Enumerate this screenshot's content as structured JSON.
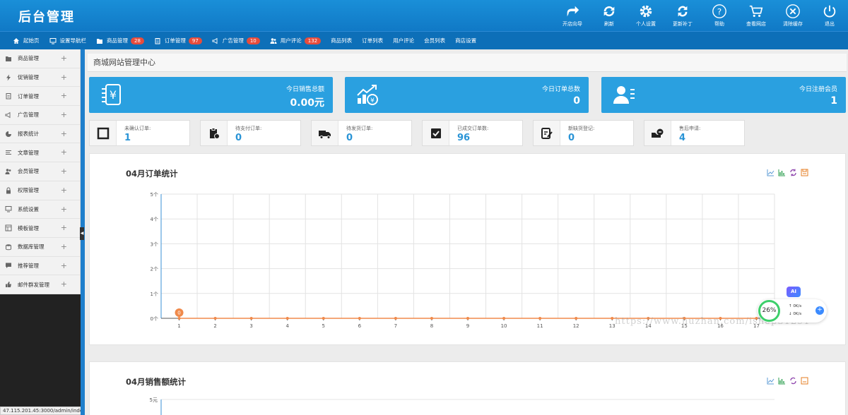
{
  "app": {
    "title": "后台管理"
  },
  "header_actions": [
    {
      "label": "开店向导",
      "icon": "share-arrow-icon"
    },
    {
      "label": "刷新",
      "icon": "refresh-icon"
    },
    {
      "label": "个人设置",
      "icon": "gear-icon"
    },
    {
      "label": "更新补丁",
      "icon": "update-icon"
    },
    {
      "label": "帮助",
      "icon": "help-icon"
    },
    {
      "label": "查看网店",
      "icon": "cart-icon"
    },
    {
      "label": "清除缓存",
      "icon": "clear-icon"
    },
    {
      "label": "退出",
      "icon": "power-icon"
    }
  ],
  "nav": [
    {
      "label": "起始页",
      "icon": "home-icon"
    },
    {
      "label": "设置导航栏",
      "icon": "monitor-icon"
    },
    {
      "label": "商品管理",
      "icon": "folder-icon",
      "badge": "28"
    },
    {
      "label": "订单管理",
      "icon": "clipboard-icon",
      "badge": "97"
    },
    {
      "label": "广告管理",
      "icon": "megaphone-icon",
      "badge": "10"
    },
    {
      "label": "用户评论",
      "icon": "users-icon",
      "badge": "132"
    },
    {
      "label": "商品列表"
    },
    {
      "label": "订单列表"
    },
    {
      "label": "用户评论"
    },
    {
      "label": "会员列表"
    },
    {
      "label": "商店设置"
    }
  ],
  "sidebar": [
    {
      "label": "商品管理",
      "icon": "folder-icon"
    },
    {
      "label": "促销管理",
      "icon": "flash-icon"
    },
    {
      "label": "订单管理",
      "icon": "clipboard-icon"
    },
    {
      "label": "广告管理",
      "icon": "megaphone-icon"
    },
    {
      "label": "报表统计",
      "icon": "pie-chart-icon"
    },
    {
      "label": "文章管理",
      "icon": "list-icon"
    },
    {
      "label": "会员管理",
      "icon": "users-icon"
    },
    {
      "label": "权限管理",
      "icon": "lock-icon"
    },
    {
      "label": "系统设置",
      "icon": "monitor-icon"
    },
    {
      "label": "模板管理",
      "icon": "template-icon"
    },
    {
      "label": "数据库管理",
      "icon": "database-icon"
    },
    {
      "label": "推荐管理",
      "icon": "comment-icon"
    },
    {
      "label": "邮件群发管理",
      "icon": "thumbs-up-icon"
    }
  ],
  "status_url": "47.115.201.45:3000/admin/index.php?act=main",
  "main": {
    "title": "商城网站管理中心",
    "stats": [
      {
        "label": "今日销售总额",
        "value": "0.00元",
        "icon": "yen-icon"
      },
      {
        "label": "今日订单总数",
        "value": "0",
        "icon": "growth-chart-icon"
      },
      {
        "label": "今日注册会员",
        "value": "1",
        "icon": "member-card-icon"
      }
    ],
    "minis": [
      {
        "label": "未确认订单:",
        "value": "1",
        "icon": "square-icon"
      },
      {
        "label": "待支付订单:",
        "value": "0",
        "icon": "pay-clipboard-icon"
      },
      {
        "label": "待发货订单:",
        "value": "0",
        "icon": "truck-icon"
      },
      {
        "label": "已成交订单数:",
        "value": "96",
        "icon": "done-order-icon"
      },
      {
        "label": "新缺货登记:",
        "value": "0",
        "icon": "register-icon"
      },
      {
        "label": "售后申请:",
        "value": "4",
        "icon": "aftersale-icon"
      }
    ],
    "order_panel_title": "04月订单统计",
    "sales_panel_title": "04月销售额统计",
    "sales_top_tick": "5元"
  },
  "chart_data": {
    "type": "line",
    "title": "04月订单统计",
    "x": [
      1,
      2,
      3,
      4,
      5,
      6,
      7,
      8,
      9,
      10,
      11,
      12,
      13,
      14,
      15,
      16,
      17
    ],
    "categories": [
      "1",
      "2",
      "3",
      "4",
      "5",
      "6",
      "7",
      "8",
      "9",
      "10",
      "11",
      "12",
      "13",
      "14",
      "15",
      "16",
      "17"
    ],
    "series": [
      {
        "values": [
          0,
          0,
          0,
          0,
          0,
          0,
          0,
          0,
          0,
          0,
          0,
          0,
          0,
          0,
          0,
          0,
          0
        ]
      }
    ],
    "data_labels": [
      "0"
    ],
    "yticks": [
      "0个",
      "1个",
      "2个",
      "3个",
      "4个",
      "5个"
    ],
    "ylim": [
      0,
      5
    ],
    "grid": true,
    "color": "#f08a4b"
  },
  "overlay": {
    "watermark": "https://www.huzhan.com/ishop31291",
    "ai_label": "AI",
    "speed_percent": "26%",
    "up_speed": "0K/s",
    "down_speed": "0K/s"
  },
  "colors": {
    "header": "#1a8fd8",
    "nav": "#0d6fb8",
    "card": "#2aa0e0",
    "value": "#2a94d6",
    "badge": "#e74c3c",
    "line": "#f08a4b"
  }
}
